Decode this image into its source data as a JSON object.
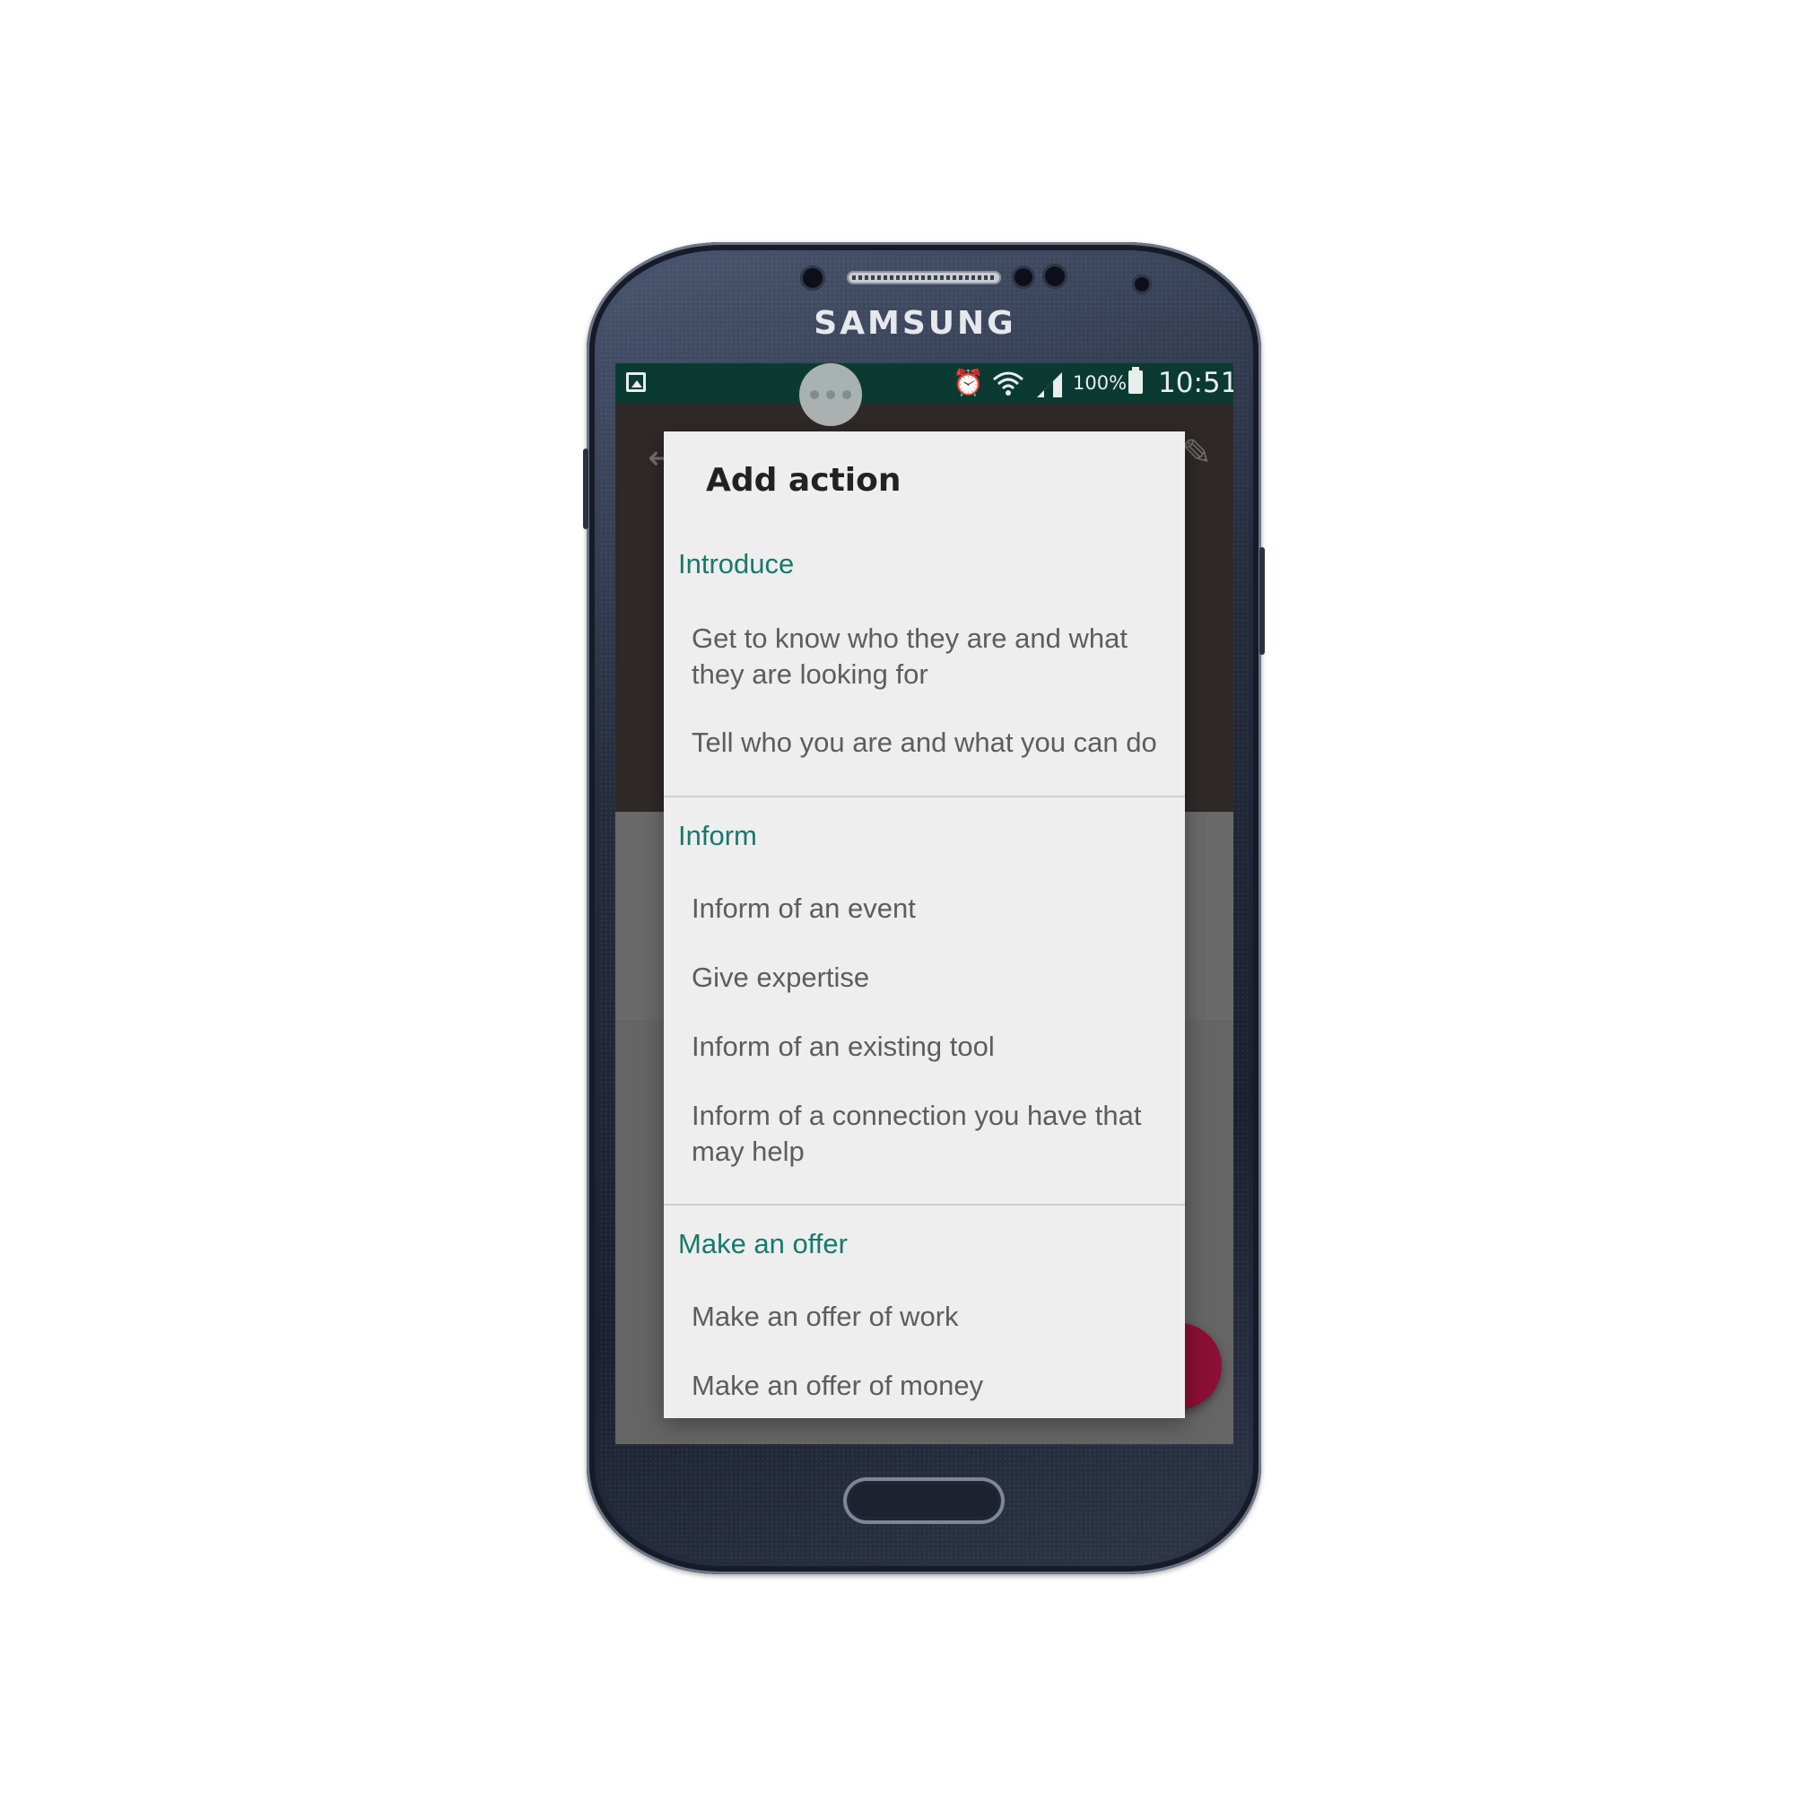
{
  "device": {
    "brand": "SAMSUNG"
  },
  "statusbar": {
    "battery_text": "100%",
    "time": "10:51",
    "icons": [
      "gallery-icon",
      "alarm-icon",
      "wifi-icon",
      "signal-icon",
      "battery-icon"
    ]
  },
  "dialog": {
    "title": "Add action",
    "sections": [
      {
        "heading": "Introduce",
        "items": [
          "Get to know who they are and what they are looking for",
          "Tell who you are and what you can do"
        ]
      },
      {
        "heading": "Inform",
        "items": [
          "Inform of an event",
          "Give expertise",
          "Inform of an existing tool",
          "Inform of a connection you have that may help"
        ]
      },
      {
        "heading": "Make an offer",
        "items": [
          "Make an offer of work",
          "Make an offer of money"
        ]
      }
    ]
  },
  "colors": {
    "statusbar": "#0b3a33",
    "section_heading": "#17796c",
    "item_text": "#5d5d5d",
    "dialog_bg": "#eeeeee",
    "fab": "#8c0f35"
  }
}
